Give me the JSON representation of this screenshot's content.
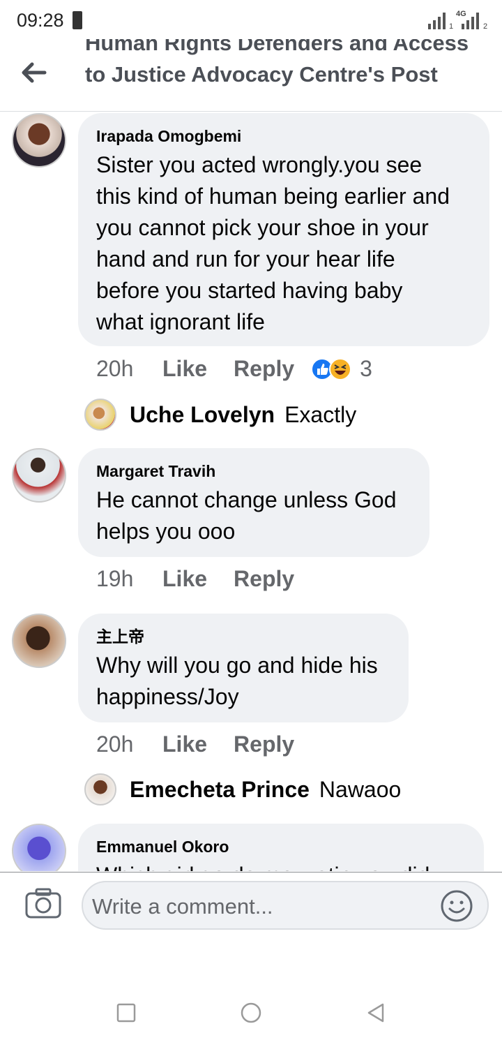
{
  "status": {
    "time": "09:28",
    "sim1": "1",
    "network": "4G",
    "sim2": "2"
  },
  "header": {
    "title": "Human Rights Defenders and Access to Justice Advocacy Centre's Post"
  },
  "comments": [
    {
      "name": "Irapada Omogbemi",
      "lines": [
        "Sister you acted wrongly.you see",
        "this kind of human being earlier and",
        "you cannot pick your shoe in your",
        "hand and run for your hear life",
        "before you started having baby",
        "what ignorant life"
      ],
      "time": "20h",
      "like": "Like",
      "reply": "Reply",
      "reaction_count": "3",
      "reaction_icons": [
        "like-icon",
        "haha-icon"
      ],
      "replies": [
        {
          "name": "Uche Lovelyn",
          "text": "Exactly"
        }
      ]
    },
    {
      "name": "Margaret Travih",
      "lines": [
        "He cannot change unless God",
        "helps you ooo"
      ],
      "time": "19h",
      "like": "Like",
      "reply": "Reply"
    },
    {
      "name": "主上帝",
      "lines": [
        "Why will you go and hide his",
        "happiness/Joy"
      ],
      "time": "20h",
      "like": "Like",
      "reply": "Reply",
      "replies": [
        {
          "name": "Emecheta Prince",
          "text": "Nawaoo"
        }
      ]
    },
    {
      "name": "Emmanuel Okoro",
      "lines": [
        "Which girl go do me watin you did"
      ]
    }
  ],
  "composer": {
    "placeholder": "Write a comment..."
  },
  "colors": {
    "bubble": "#eff1f4",
    "meta": "#65676b",
    "like_blue": "#1877f2",
    "haha_yellow": "#f7b125"
  }
}
